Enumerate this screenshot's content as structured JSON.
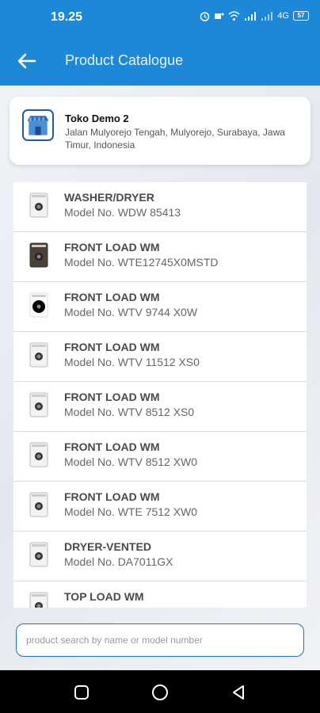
{
  "status_bar": {
    "time": "19.25",
    "battery": "57",
    "network": "4G"
  },
  "app_bar": {
    "title": "Product Catalogue",
    "back_icon": "arrow-left-icon"
  },
  "store": {
    "icon": "store-icon",
    "name": "Toko Demo 2",
    "address": "Jalan Mulyorejo Tengah, Mulyorejo, Surabaya, Jawa Timur, Indonesia"
  },
  "products": [
    {
      "name": "WASHER/DRYER",
      "model": "Model No. WDW 85413",
      "thumb": "white"
    },
    {
      "name": "FRONT LOAD WM",
      "model": "Model No. WTE12745X0MSTD",
      "thumb": "dark"
    },
    {
      "name": "FRONT LOAD WM",
      "model": "Model No. WTV 9744 X0W",
      "thumb": "black-door"
    },
    {
      "name": "FRONT LOAD WM",
      "model": "Model No. WTV 11512 XS0",
      "thumb": "white"
    },
    {
      "name": "FRONT LOAD WM",
      "model": "Model No. WTV 8512 XS0",
      "thumb": "white"
    },
    {
      "name": "FRONT LOAD WM",
      "model": "Model No. WTV 8512 XW0",
      "thumb": "white"
    },
    {
      "name": "FRONT LOAD WM",
      "model": "Model No. WTE 7512 XW0",
      "thumb": "white"
    },
    {
      "name": "DRYER-VENTED",
      "model": "Model No. DA7011GX",
      "thumb": "white"
    },
    {
      "name": "TOP LOAD WM",
      "model": "",
      "thumb": "white"
    }
  ],
  "search": {
    "placeholder": "product search by name or model number",
    "value": ""
  },
  "nav": {
    "recents_icon": "square-icon",
    "home_icon": "circle-icon",
    "back_icon": "triangle-back-icon"
  },
  "colors": {
    "primary": "#1e88d8",
    "search_border": "#1e6fd0"
  }
}
